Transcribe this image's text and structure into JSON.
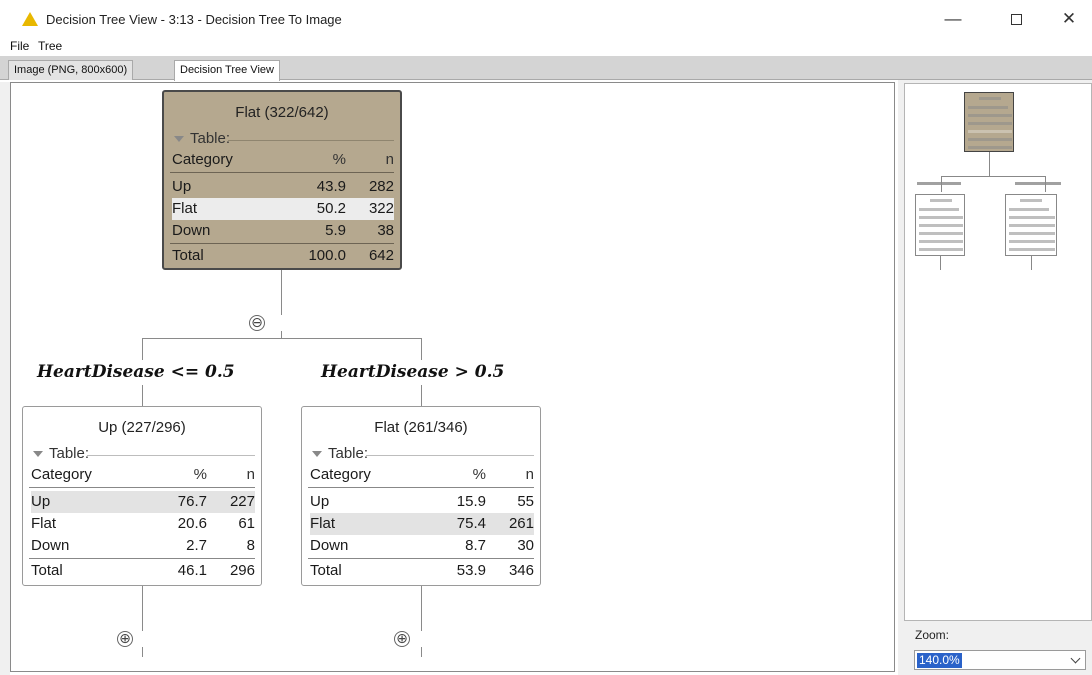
{
  "window": {
    "title": "Decision Tree View - 3:13 - Decision Tree To Image",
    "min_glyph": "—",
    "close_glyph": "✕",
    "warning_icon": "warning-triangle-icon"
  },
  "menu": [
    "File",
    "Tree"
  ],
  "tabs": [
    {
      "label": "Image (PNG, 800x600)",
      "active": false
    },
    {
      "label": "Decision Tree View",
      "active": true
    }
  ],
  "tree": {
    "root": {
      "title": "Flat (322/642)",
      "table_label": "Table:",
      "header": {
        "category": "Category",
        "pct": "%",
        "n": "n"
      },
      "rows": [
        {
          "category": "Up",
          "pct": "43.9",
          "n": "282"
        },
        {
          "category": "Flat",
          "pct": "50.2",
          "n": "322"
        },
        {
          "category": "Down",
          "pct": "5.9",
          "n": "38"
        }
      ],
      "total": {
        "category": "Total",
        "pct": "100.0",
        "n": "642"
      },
      "collapse_glyph": "⊖"
    },
    "left_condition": "HeartDisease <= 0.5",
    "right_condition": "HeartDisease > 0.5",
    "left": {
      "title": "Up (227/296)",
      "table_label": "Table:",
      "header": {
        "category": "Category",
        "pct": "%",
        "n": "n"
      },
      "rows": [
        {
          "category": "Up",
          "pct": "76.7",
          "n": "227"
        },
        {
          "category": "Flat",
          "pct": "20.6",
          "n": "61"
        },
        {
          "category": "Down",
          "pct": "2.7",
          "n": "8"
        }
      ],
      "total": {
        "category": "Total",
        "pct": "46.1",
        "n": "296"
      },
      "expand_glyph": "⊕"
    },
    "right": {
      "title": "Flat (261/346)",
      "table_label": "Table:",
      "header": {
        "category": "Category",
        "pct": "%",
        "n": "n"
      },
      "rows": [
        {
          "category": "Up",
          "pct": "15.9",
          "n": "55"
        },
        {
          "category": "Flat",
          "pct": "75.4",
          "n": "261"
        },
        {
          "category": "Down",
          "pct": "8.7",
          "n": "30"
        }
      ],
      "total": {
        "category": "Total",
        "pct": "53.9",
        "n": "346"
      },
      "expand_glyph": "⊕"
    }
  },
  "zoom": {
    "label": "Zoom:",
    "value": "140.0%"
  },
  "colors": {
    "root_node": "#b5a88f",
    "selection": "#2a62c9",
    "warning": "#e8b800"
  }
}
